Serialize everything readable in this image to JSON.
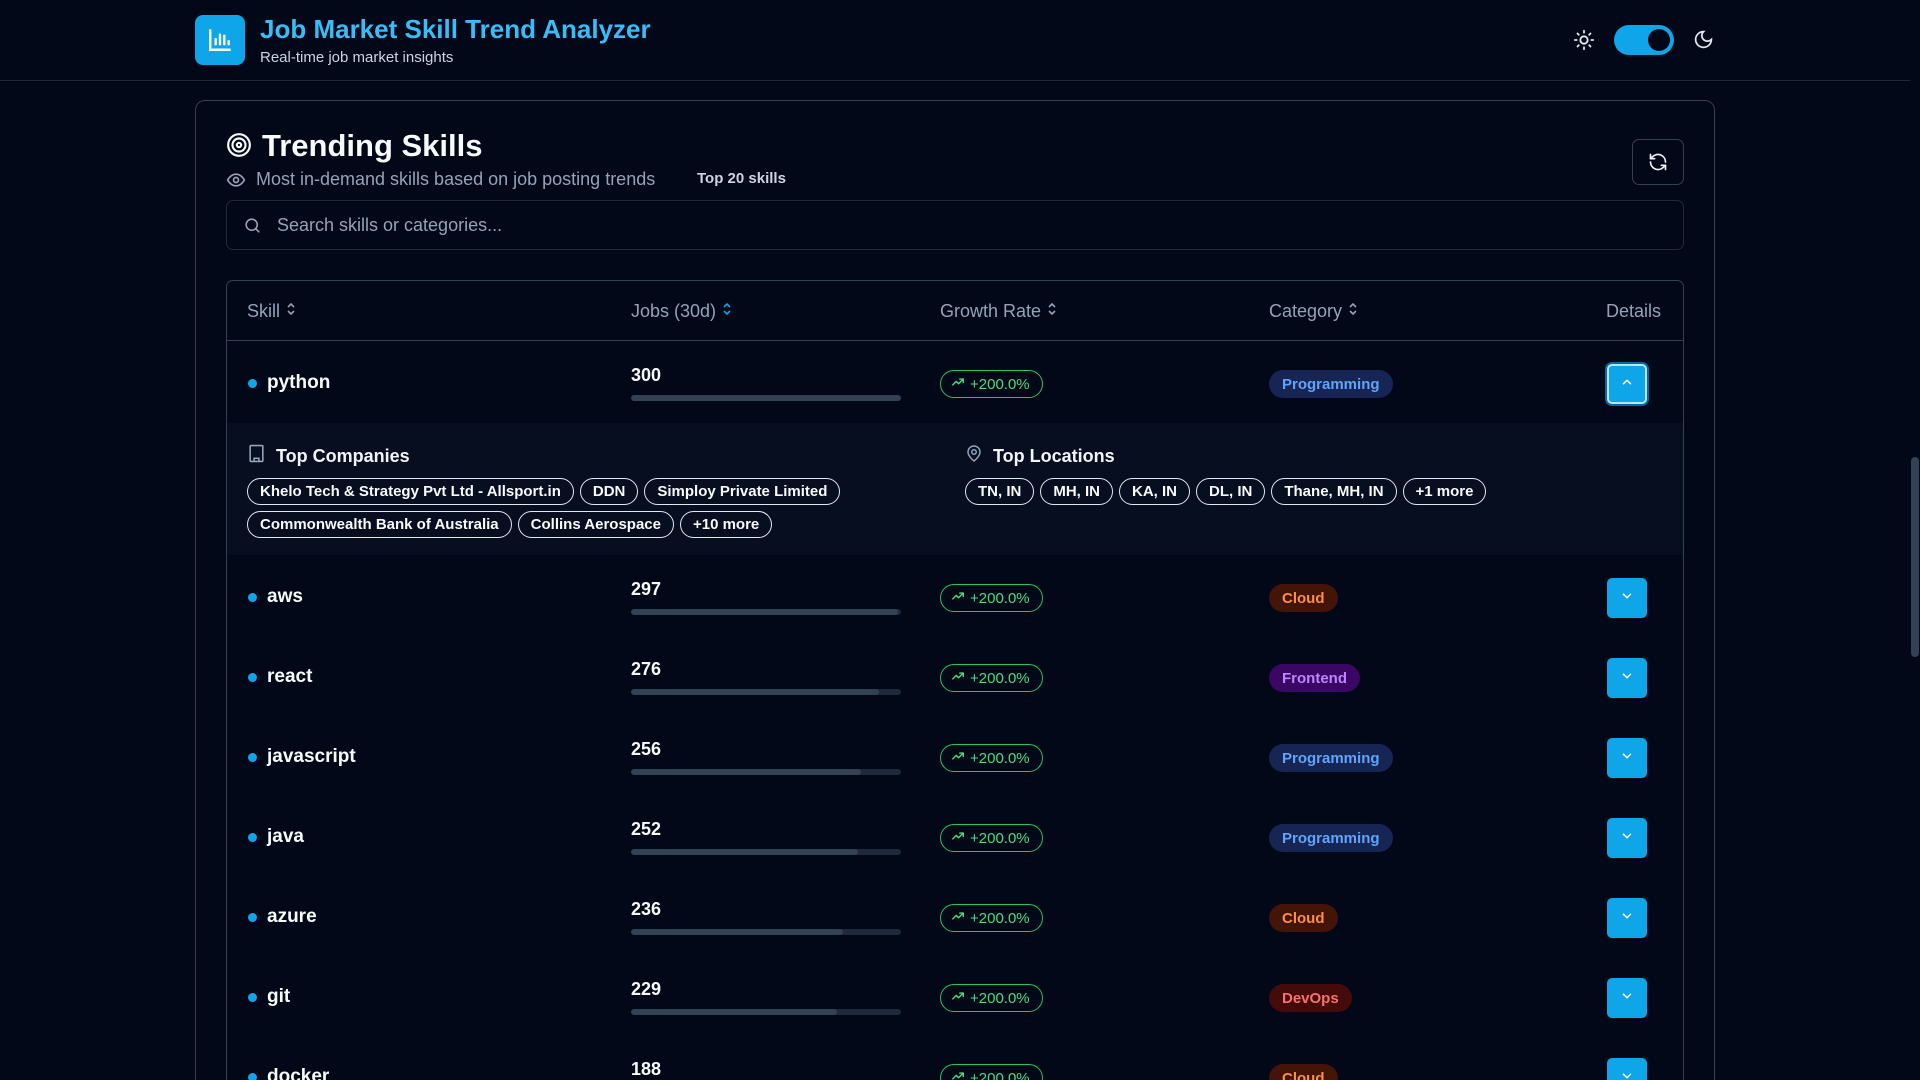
{
  "app": {
    "title": "Job Market Skill Trend Analyzer",
    "subtitle": "Real-time job market insights",
    "logo_icon": "bar-chart-icon"
  },
  "theme": {
    "sun_icon": "sun-icon",
    "moon_icon": "moon-icon",
    "dark_mode": true
  },
  "card": {
    "title": "Trending Skills",
    "subtitle": "Most in-demand skills based on job posting trends",
    "badge": "Top 20 skills"
  },
  "search": {
    "placeholder": "Search skills or categories...",
    "value": ""
  },
  "table": {
    "columns": [
      "Skill",
      "Jobs (30d)",
      "Growth Rate",
      "Category",
      "Details"
    ],
    "max_jobs": 300,
    "rows": [
      {
        "skill": "python",
        "jobs": "300",
        "jobs_value": 300,
        "growth": "+200.0%",
        "category": "Programming",
        "expanded": true
      },
      {
        "skill": "aws",
        "jobs": "297",
        "jobs_value": 297,
        "growth": "+200.0%",
        "category": "Cloud",
        "expanded": false
      },
      {
        "skill": "react",
        "jobs": "276",
        "jobs_value": 276,
        "growth": "+200.0%",
        "category": "Frontend",
        "expanded": false
      },
      {
        "skill": "javascript",
        "jobs": "256",
        "jobs_value": 256,
        "growth": "+200.0%",
        "category": "Programming",
        "expanded": false
      },
      {
        "skill": "java",
        "jobs": "252",
        "jobs_value": 252,
        "growth": "+200.0%",
        "category": "Programming",
        "expanded": false
      },
      {
        "skill": "azure",
        "jobs": "236",
        "jobs_value": 236,
        "growth": "+200.0%",
        "category": "Cloud",
        "expanded": false
      },
      {
        "skill": "git",
        "jobs": "229",
        "jobs_value": 229,
        "growth": "+200.0%",
        "category": "DevOps",
        "expanded": false
      },
      {
        "skill": "docker",
        "jobs": "188",
        "jobs_value": 188,
        "growth": "+200.0%",
        "category": "Cloud",
        "expanded": false
      }
    ]
  },
  "expanded": {
    "companies_title": "Top Companies",
    "companies": [
      "Khelo Tech & Strategy Pvt Ltd - Allsport.in",
      "DDN",
      "Simploy Private Limited",
      "Commonwealth Bank of Australia",
      "Collins Aerospace",
      "+10 more"
    ],
    "locations_title": "Top Locations",
    "locations": [
      "TN, IN",
      "MH, IN",
      "KA, IN",
      "DL, IN",
      "Thane, MH, IN",
      "+1 more"
    ]
  },
  "category_colors": {
    "Programming": {
      "bg": "#172554",
      "fg": "#60a5fa"
    },
    "Cloud": {
      "bg": "#431407",
      "fg": "#fb923c"
    },
    "Frontend": {
      "bg": "#3b0764",
      "fg": "#c084fc"
    },
    "DevOps": {
      "bg": "#450a0a",
      "fg": "#f87171"
    }
  },
  "colors": {
    "accent": "#0ea5e9",
    "growth": "#4ade80",
    "background": "#020817"
  }
}
